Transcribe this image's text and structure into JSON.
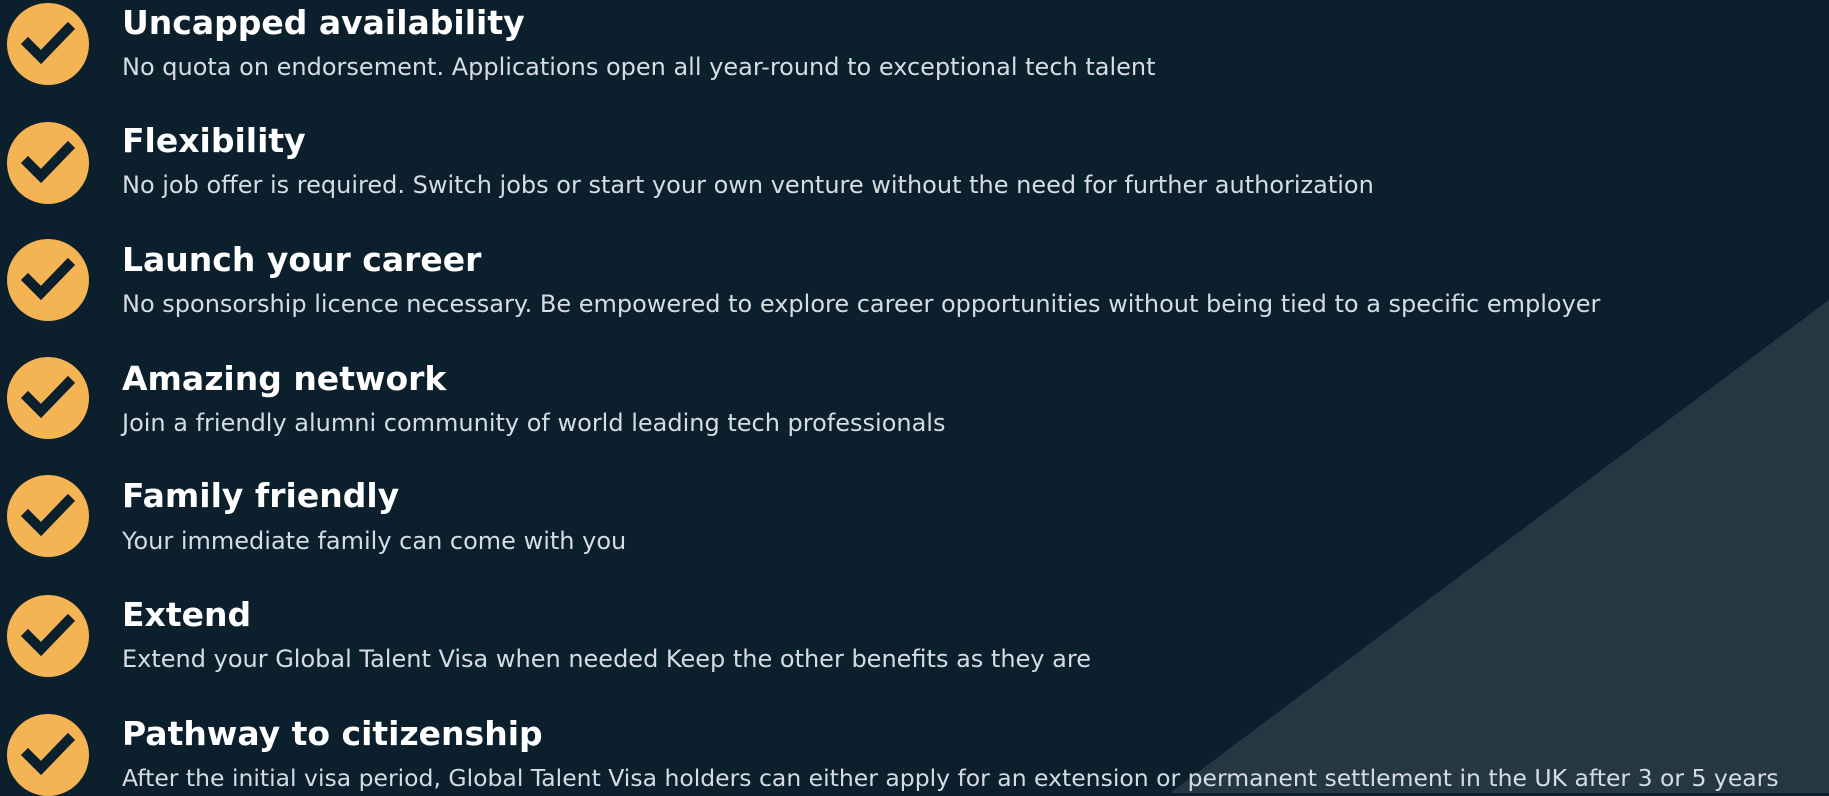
{
  "colors": {
    "background": "#0b1f2c",
    "background_triangle": "#263744",
    "check_circle": "#f5b454",
    "check_mark": "#0b1f2c",
    "title_text": "#ffffff",
    "description_text": "#d5dde3"
  },
  "benefits": [
    {
      "icon": "checkmark-circle-icon",
      "title": "Uncapped availability",
      "description": "No quota on endorsement. Applications open all year-round to exceptional tech talent"
    },
    {
      "icon": "checkmark-circle-icon",
      "title": "Flexibility",
      "description": "No job offer is required. Switch jobs or start your own venture without the need for further authorization"
    },
    {
      "icon": "checkmark-circle-icon",
      "title": "Launch your career",
      "description": "No sponsorship licence necessary. Be empowered to explore career opportunities without being tied to a specific employer"
    },
    {
      "icon": "checkmark-circle-icon",
      "title": "Amazing network",
      "description": "Join a friendly alumni community of world leading tech professionals"
    },
    {
      "icon": "checkmark-circle-icon",
      "title": "Family friendly",
      "description": "Your immediate family can come with you"
    },
    {
      "icon": "checkmark-circle-icon",
      "title": "Extend",
      "description": "Extend your Global Talent Visa when needed Keep the other benefits as they are"
    },
    {
      "icon": "checkmark-circle-icon",
      "title": "Pathway to citizenship",
      "description": "After the initial visa period, Global Talent Visa holders can either apply for an extension or permanent settlement in the UK after 3 or 5 years"
    }
  ]
}
